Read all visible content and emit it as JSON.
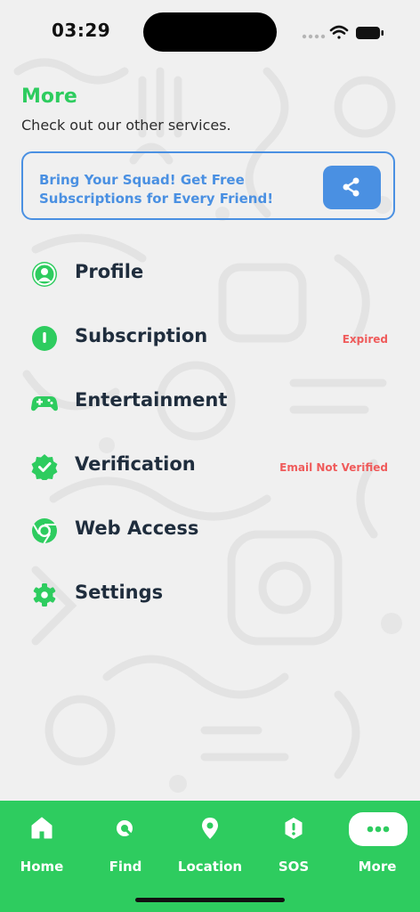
{
  "status_bar": {
    "time": "03:29"
  },
  "header": {
    "title": "More",
    "subtitle": "Check out our other services."
  },
  "invite_banner": {
    "text": "Bring Your Squad! Get Free Subscriptions for Every Friend!",
    "button_icon": "share-icon"
  },
  "menu": {
    "items": [
      {
        "label": "Profile",
        "icon": "profile-icon",
        "badge": ""
      },
      {
        "label": "Subscription",
        "icon": "subscription-icon",
        "badge": "Expired"
      },
      {
        "label": "Entertainment",
        "icon": "gamepad-icon",
        "badge": ""
      },
      {
        "label": "Verification",
        "icon": "verified-badge-icon",
        "badge": "Email Not Verified"
      },
      {
        "label": "Web Access",
        "icon": "chrome-icon",
        "badge": ""
      },
      {
        "label": "Settings",
        "icon": "gear-icon",
        "badge": ""
      }
    ]
  },
  "tabbar": {
    "tabs": [
      {
        "label": "Home",
        "icon": "home-icon"
      },
      {
        "label": "Find",
        "icon": "find-icon"
      },
      {
        "label": "Location",
        "icon": "location-pin-icon"
      },
      {
        "label": "SOS",
        "icon": "sos-icon"
      },
      {
        "label": "More",
        "icon": "more-dots-icon",
        "active": true
      }
    ]
  },
  "colors": {
    "accent_green": "#2ecc5f",
    "link_blue": "#4a90e2",
    "badge_red": "#ef5b5b",
    "text_dark": "#1f2d3d"
  }
}
